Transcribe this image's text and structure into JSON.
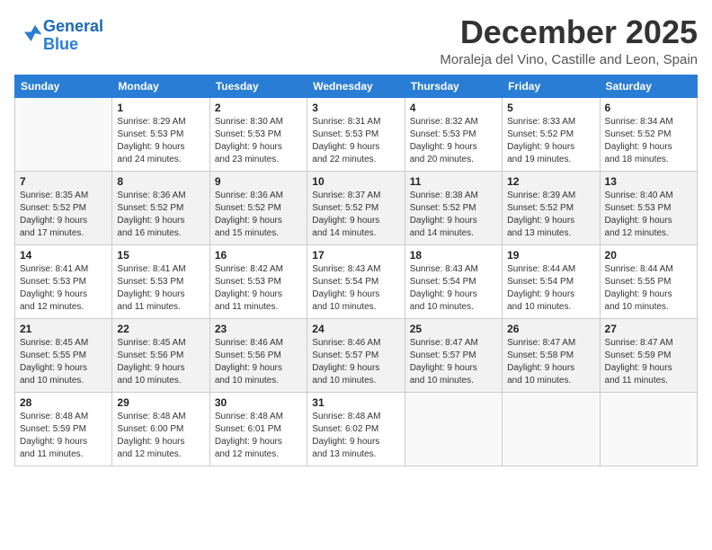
{
  "header": {
    "logo_line1": "General",
    "logo_line2": "Blue",
    "month": "December 2025",
    "location": "Moraleja del Vino, Castille and Leon, Spain"
  },
  "weekdays": [
    "Sunday",
    "Monday",
    "Tuesday",
    "Wednesday",
    "Thursday",
    "Friday",
    "Saturday"
  ],
  "weeks": [
    [
      {
        "day": "",
        "info": ""
      },
      {
        "day": "1",
        "info": "Sunrise: 8:29 AM\nSunset: 5:53 PM\nDaylight: 9 hours\nand 24 minutes."
      },
      {
        "day": "2",
        "info": "Sunrise: 8:30 AM\nSunset: 5:53 PM\nDaylight: 9 hours\nand 23 minutes."
      },
      {
        "day": "3",
        "info": "Sunrise: 8:31 AM\nSunset: 5:53 PM\nDaylight: 9 hours\nand 22 minutes."
      },
      {
        "day": "4",
        "info": "Sunrise: 8:32 AM\nSunset: 5:53 PM\nDaylight: 9 hours\nand 20 minutes."
      },
      {
        "day": "5",
        "info": "Sunrise: 8:33 AM\nSunset: 5:52 PM\nDaylight: 9 hours\nand 19 minutes."
      },
      {
        "day": "6",
        "info": "Sunrise: 8:34 AM\nSunset: 5:52 PM\nDaylight: 9 hours\nand 18 minutes."
      }
    ],
    [
      {
        "day": "7",
        "info": "Sunrise: 8:35 AM\nSunset: 5:52 PM\nDaylight: 9 hours\nand 17 minutes."
      },
      {
        "day": "8",
        "info": "Sunrise: 8:36 AM\nSunset: 5:52 PM\nDaylight: 9 hours\nand 16 minutes."
      },
      {
        "day": "9",
        "info": "Sunrise: 8:36 AM\nSunset: 5:52 PM\nDaylight: 9 hours\nand 15 minutes."
      },
      {
        "day": "10",
        "info": "Sunrise: 8:37 AM\nSunset: 5:52 PM\nDaylight: 9 hours\nand 14 minutes."
      },
      {
        "day": "11",
        "info": "Sunrise: 8:38 AM\nSunset: 5:52 PM\nDaylight: 9 hours\nand 14 minutes."
      },
      {
        "day": "12",
        "info": "Sunrise: 8:39 AM\nSunset: 5:52 PM\nDaylight: 9 hours\nand 13 minutes."
      },
      {
        "day": "13",
        "info": "Sunrise: 8:40 AM\nSunset: 5:53 PM\nDaylight: 9 hours\nand 12 minutes."
      }
    ],
    [
      {
        "day": "14",
        "info": "Sunrise: 8:41 AM\nSunset: 5:53 PM\nDaylight: 9 hours\nand 12 minutes."
      },
      {
        "day": "15",
        "info": "Sunrise: 8:41 AM\nSunset: 5:53 PM\nDaylight: 9 hours\nand 11 minutes."
      },
      {
        "day": "16",
        "info": "Sunrise: 8:42 AM\nSunset: 5:53 PM\nDaylight: 9 hours\nand 11 minutes."
      },
      {
        "day": "17",
        "info": "Sunrise: 8:43 AM\nSunset: 5:54 PM\nDaylight: 9 hours\nand 10 minutes."
      },
      {
        "day": "18",
        "info": "Sunrise: 8:43 AM\nSunset: 5:54 PM\nDaylight: 9 hours\nand 10 minutes."
      },
      {
        "day": "19",
        "info": "Sunrise: 8:44 AM\nSunset: 5:54 PM\nDaylight: 9 hours\nand 10 minutes."
      },
      {
        "day": "20",
        "info": "Sunrise: 8:44 AM\nSunset: 5:55 PM\nDaylight: 9 hours\nand 10 minutes."
      }
    ],
    [
      {
        "day": "21",
        "info": "Sunrise: 8:45 AM\nSunset: 5:55 PM\nDaylight: 9 hours\nand 10 minutes."
      },
      {
        "day": "22",
        "info": "Sunrise: 8:45 AM\nSunset: 5:56 PM\nDaylight: 9 hours\nand 10 minutes."
      },
      {
        "day": "23",
        "info": "Sunrise: 8:46 AM\nSunset: 5:56 PM\nDaylight: 9 hours\nand 10 minutes."
      },
      {
        "day": "24",
        "info": "Sunrise: 8:46 AM\nSunset: 5:57 PM\nDaylight: 9 hours\nand 10 minutes."
      },
      {
        "day": "25",
        "info": "Sunrise: 8:47 AM\nSunset: 5:57 PM\nDaylight: 9 hours\nand 10 minutes."
      },
      {
        "day": "26",
        "info": "Sunrise: 8:47 AM\nSunset: 5:58 PM\nDaylight: 9 hours\nand 10 minutes."
      },
      {
        "day": "27",
        "info": "Sunrise: 8:47 AM\nSunset: 5:59 PM\nDaylight: 9 hours\nand 11 minutes."
      }
    ],
    [
      {
        "day": "28",
        "info": "Sunrise: 8:48 AM\nSunset: 5:59 PM\nDaylight: 9 hours\nand 11 minutes."
      },
      {
        "day": "29",
        "info": "Sunrise: 8:48 AM\nSunset: 6:00 PM\nDaylight: 9 hours\nand 12 minutes."
      },
      {
        "day": "30",
        "info": "Sunrise: 8:48 AM\nSunset: 6:01 PM\nDaylight: 9 hours\nand 12 minutes."
      },
      {
        "day": "31",
        "info": "Sunrise: 8:48 AM\nSunset: 6:02 PM\nDaylight: 9 hours\nand 13 minutes."
      },
      {
        "day": "",
        "info": ""
      },
      {
        "day": "",
        "info": ""
      },
      {
        "day": "",
        "info": ""
      }
    ]
  ]
}
